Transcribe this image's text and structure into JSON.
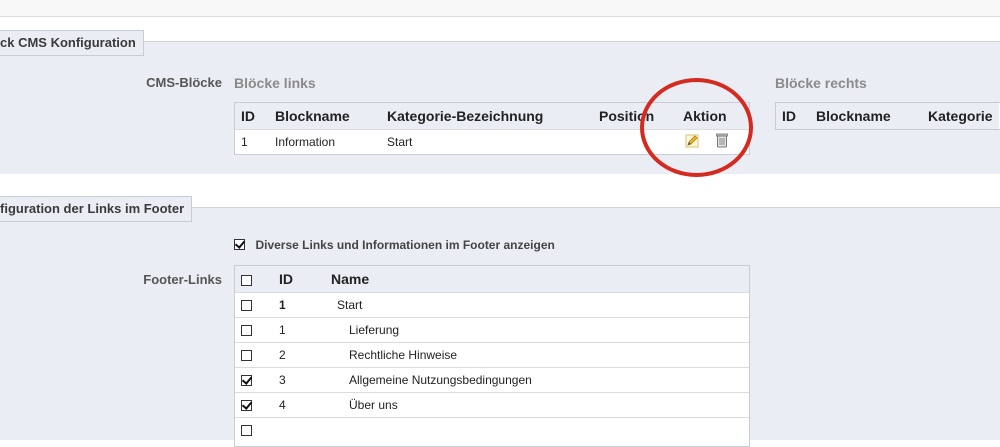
{
  "cms_section": {
    "legend": "ck CMS Konfiguration",
    "label": "CMS-Blöcke",
    "left": {
      "title": "Blöcke links",
      "headers": [
        "ID",
        "Blockname",
        "Kategorie-Bezeichnung",
        "Position",
        "Aktion"
      ],
      "rows": [
        {
          "id": "1",
          "blockname": "Information",
          "kategorie": "Start",
          "position": ""
        }
      ]
    },
    "right": {
      "title": "Blöcke rechts",
      "headers": [
        "ID",
        "Blockname",
        "Kategorie"
      ]
    }
  },
  "footer_section": {
    "legend": "figuration der Links im Footer",
    "checkbox_label": "Diverse Links und Informationen im Footer anzeigen",
    "checkbox_checked": true,
    "label": "Footer-Links",
    "headers": [
      "ID",
      "Name"
    ],
    "rows": [
      {
        "id": "1",
        "name": "Start",
        "checked": false,
        "bold": true
      },
      {
        "id": "1",
        "name": "Lieferung",
        "checked": false
      },
      {
        "id": "2",
        "name": "Rechtliche Hinweise",
        "checked": false
      },
      {
        "id": "3",
        "name": "Allgemeine Nutzungsbedingungen",
        "checked": true
      },
      {
        "id": "4",
        "name": "Über uns",
        "checked": true
      }
    ]
  },
  "icons": {
    "edit": "pencil-edit-icon",
    "delete": "trash-delete-icon"
  },
  "colors": {
    "highlight_circle": "#d52a1f",
    "section_bg": "#ebedf4"
  }
}
